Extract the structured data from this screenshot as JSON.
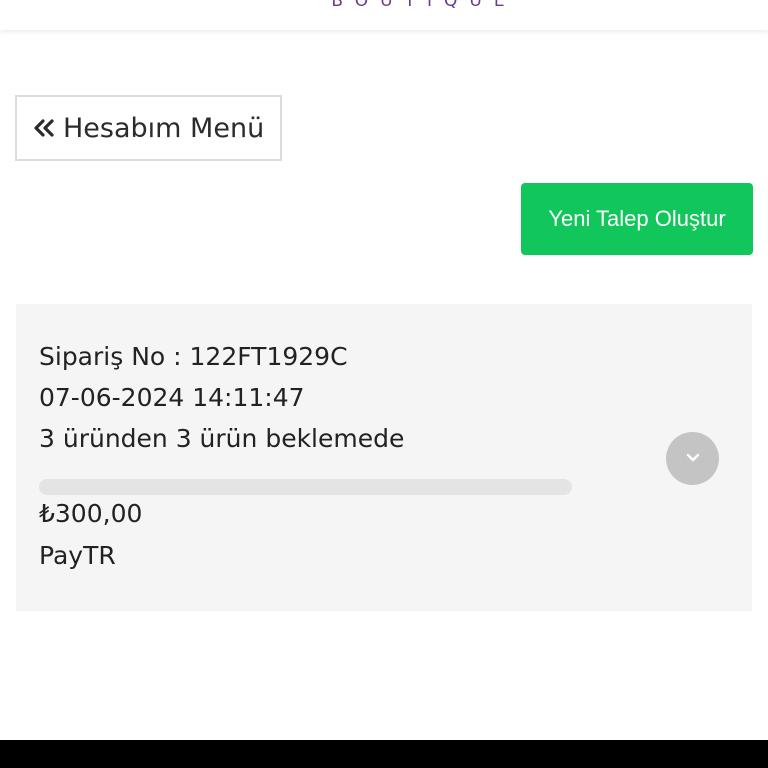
{
  "header": {
    "brand_subtitle": "BOUTIQUE"
  },
  "back_button": {
    "label": "Hesabım Menü",
    "icon": "double-chevron-left-icon"
  },
  "new_request_button": {
    "label": "Yeni Talep Oluştur",
    "color": "#11c65a"
  },
  "order": {
    "order_no": "Sipariş No : 122FT1929C",
    "datetime": "07-06-2024 14:11:47",
    "status": "3 üründen 3 ürün beklemede",
    "progress": 0,
    "amount": "₺300,00",
    "payment_method": "PayTR",
    "expand_icon": "chevron-down-icon"
  }
}
